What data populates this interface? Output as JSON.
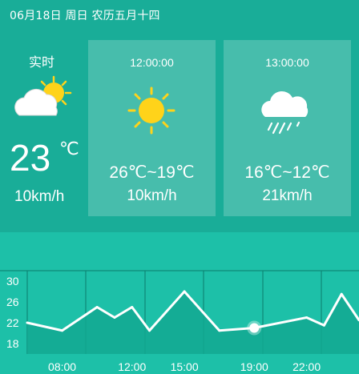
{
  "header": {
    "date_text": "06月18日 周日 农历五月十四"
  },
  "current": {
    "label": "实时",
    "icon": "partly-cloudy-icon",
    "temperature": "23",
    "unit": "℃",
    "wind": "10km/h"
  },
  "forecast": [
    {
      "time": "12:00:00",
      "icon": "sun-icon",
      "range": "26℃~19℃",
      "wind": "10km/h"
    },
    {
      "time": "13:00:00",
      "icon": "rain-cloud-icon",
      "range": "16℃~12℃",
      "wind": "21km/h"
    }
  ],
  "colors": {
    "background": "#19ad98",
    "chart_background": "#1dc0a8",
    "sun": "#ffd31a",
    "line": "#ffffff"
  },
  "chart_data": {
    "type": "area",
    "title": "",
    "xlabel": "",
    "ylabel": "",
    "x_ticks": [
      "08:00",
      "12:00",
      "15:00",
      "19:00",
      "22:00"
    ],
    "y_ticks": [
      18,
      22,
      26,
      30
    ],
    "ylim": [
      16,
      32
    ],
    "grid": true,
    "series": [
      {
        "x": [
          "06:00",
          "08:00",
          "10:00",
          "11:00",
          "12:00",
          "13:00",
          "15:00",
          "17:00",
          "19:00",
          "22:00",
          "23:00",
          "24:00",
          "25:00"
        ],
        "values": [
          22,
          20.5,
          25,
          23,
          25,
          20.5,
          28,
          20.5,
          21,
          23,
          21.5,
          27.5,
          22.5
        ],
        "highlight_index": 8
      }
    ]
  }
}
